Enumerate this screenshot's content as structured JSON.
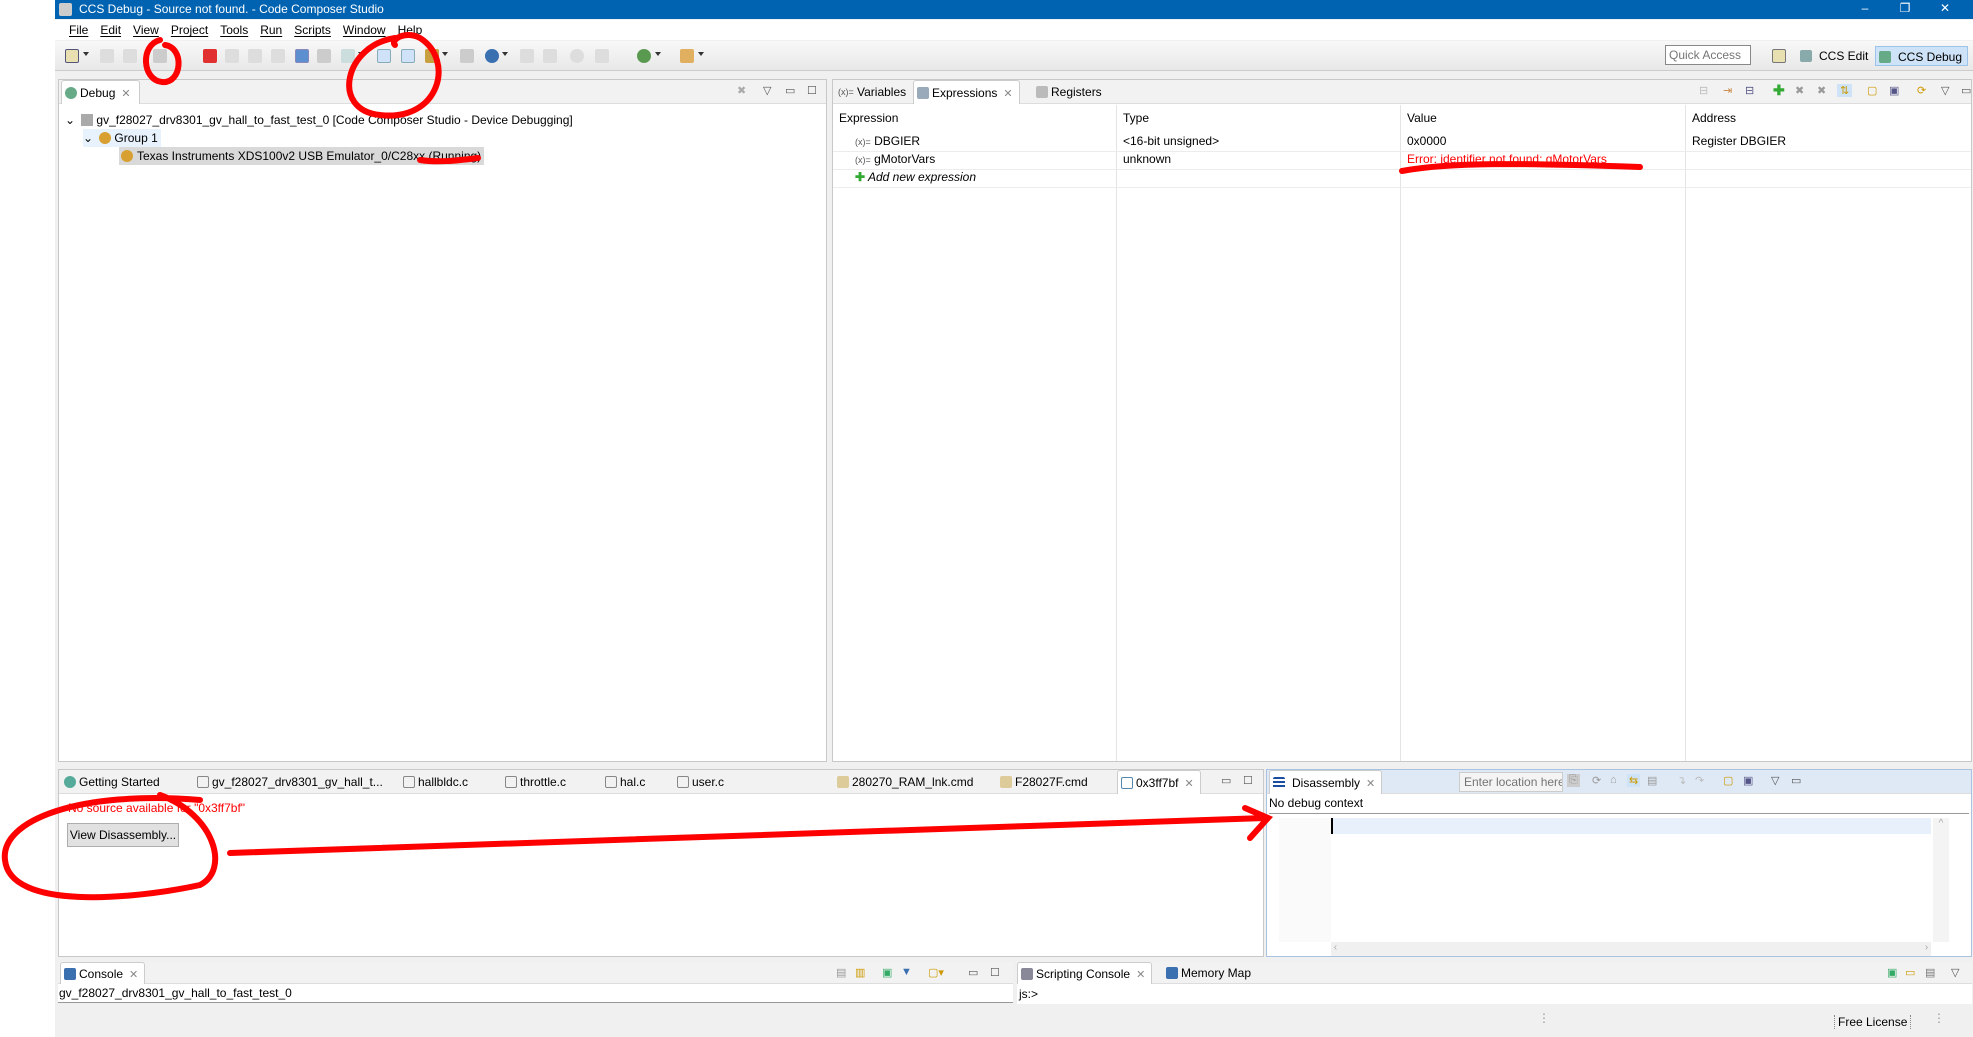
{
  "window": {
    "title": "CCS Debug - Source not found. - Code Composer Studio",
    "controls": [
      "–",
      "❐",
      "✕"
    ]
  },
  "menu": [
    "File",
    "Edit",
    "View",
    "Project",
    "Tools",
    "Run",
    "Scripts",
    "Window",
    "Help"
  ],
  "toolbar": {
    "quick_access_placeholder": "Quick Access",
    "perspectives": [
      "CCS Edit",
      "CCS Debug"
    ]
  },
  "debug": {
    "tab": "Debug",
    "tree": [
      {
        "label": "gv_f28027_drv8301_gv_hall_to_fast_test_0 [Code Composer Studio - Device Debugging]"
      },
      {
        "label": "Group 1"
      },
      {
        "label": "Texas Instruments XDS100v2 USB Emulator_0/C28xx (Running)"
      }
    ]
  },
  "expressions": {
    "tabs": [
      "Variables",
      "Expressions",
      "Registers"
    ],
    "columns": [
      "Expression",
      "Type",
      "Value",
      "Address"
    ],
    "rows": [
      {
        "expression": "DBGIER",
        "type": "<16-bit unsigned>",
        "value": "0x0000",
        "address": "Register DBGIER"
      },
      {
        "expression": "gMotorVars",
        "type": "unknown",
        "value": "Error: identifier not found: gMotorVars",
        "address": ""
      }
    ],
    "add_label": "Add new expression",
    "error_color": "#ff0000"
  },
  "editor": {
    "tabs": [
      "Getting Started",
      "gv_f28027_drv8301_gv_hall_t...",
      "hallbldc.c",
      "throttle.c",
      "hal.c",
      "user.c",
      "280270_RAM_lnk.cmd",
      "F28027F.cmd",
      "0x3ff7bf"
    ],
    "message": "No source available for \"0x3ff7bf\"",
    "button": "View Disassembly..."
  },
  "disassembly": {
    "tab": "Disassembly",
    "location_placeholder": "Enter location here",
    "context": "No debug context"
  },
  "console": {
    "tab": "Console",
    "text": "gv_f28027_drv8301_gv_hall_to_fast_test_0"
  },
  "scripting": {
    "tabs": [
      "Scripting Console",
      "Memory Map"
    ],
    "prompt": "js:>"
  },
  "status": {
    "license": "Free License"
  },
  "annotation_color": "#ff0000"
}
